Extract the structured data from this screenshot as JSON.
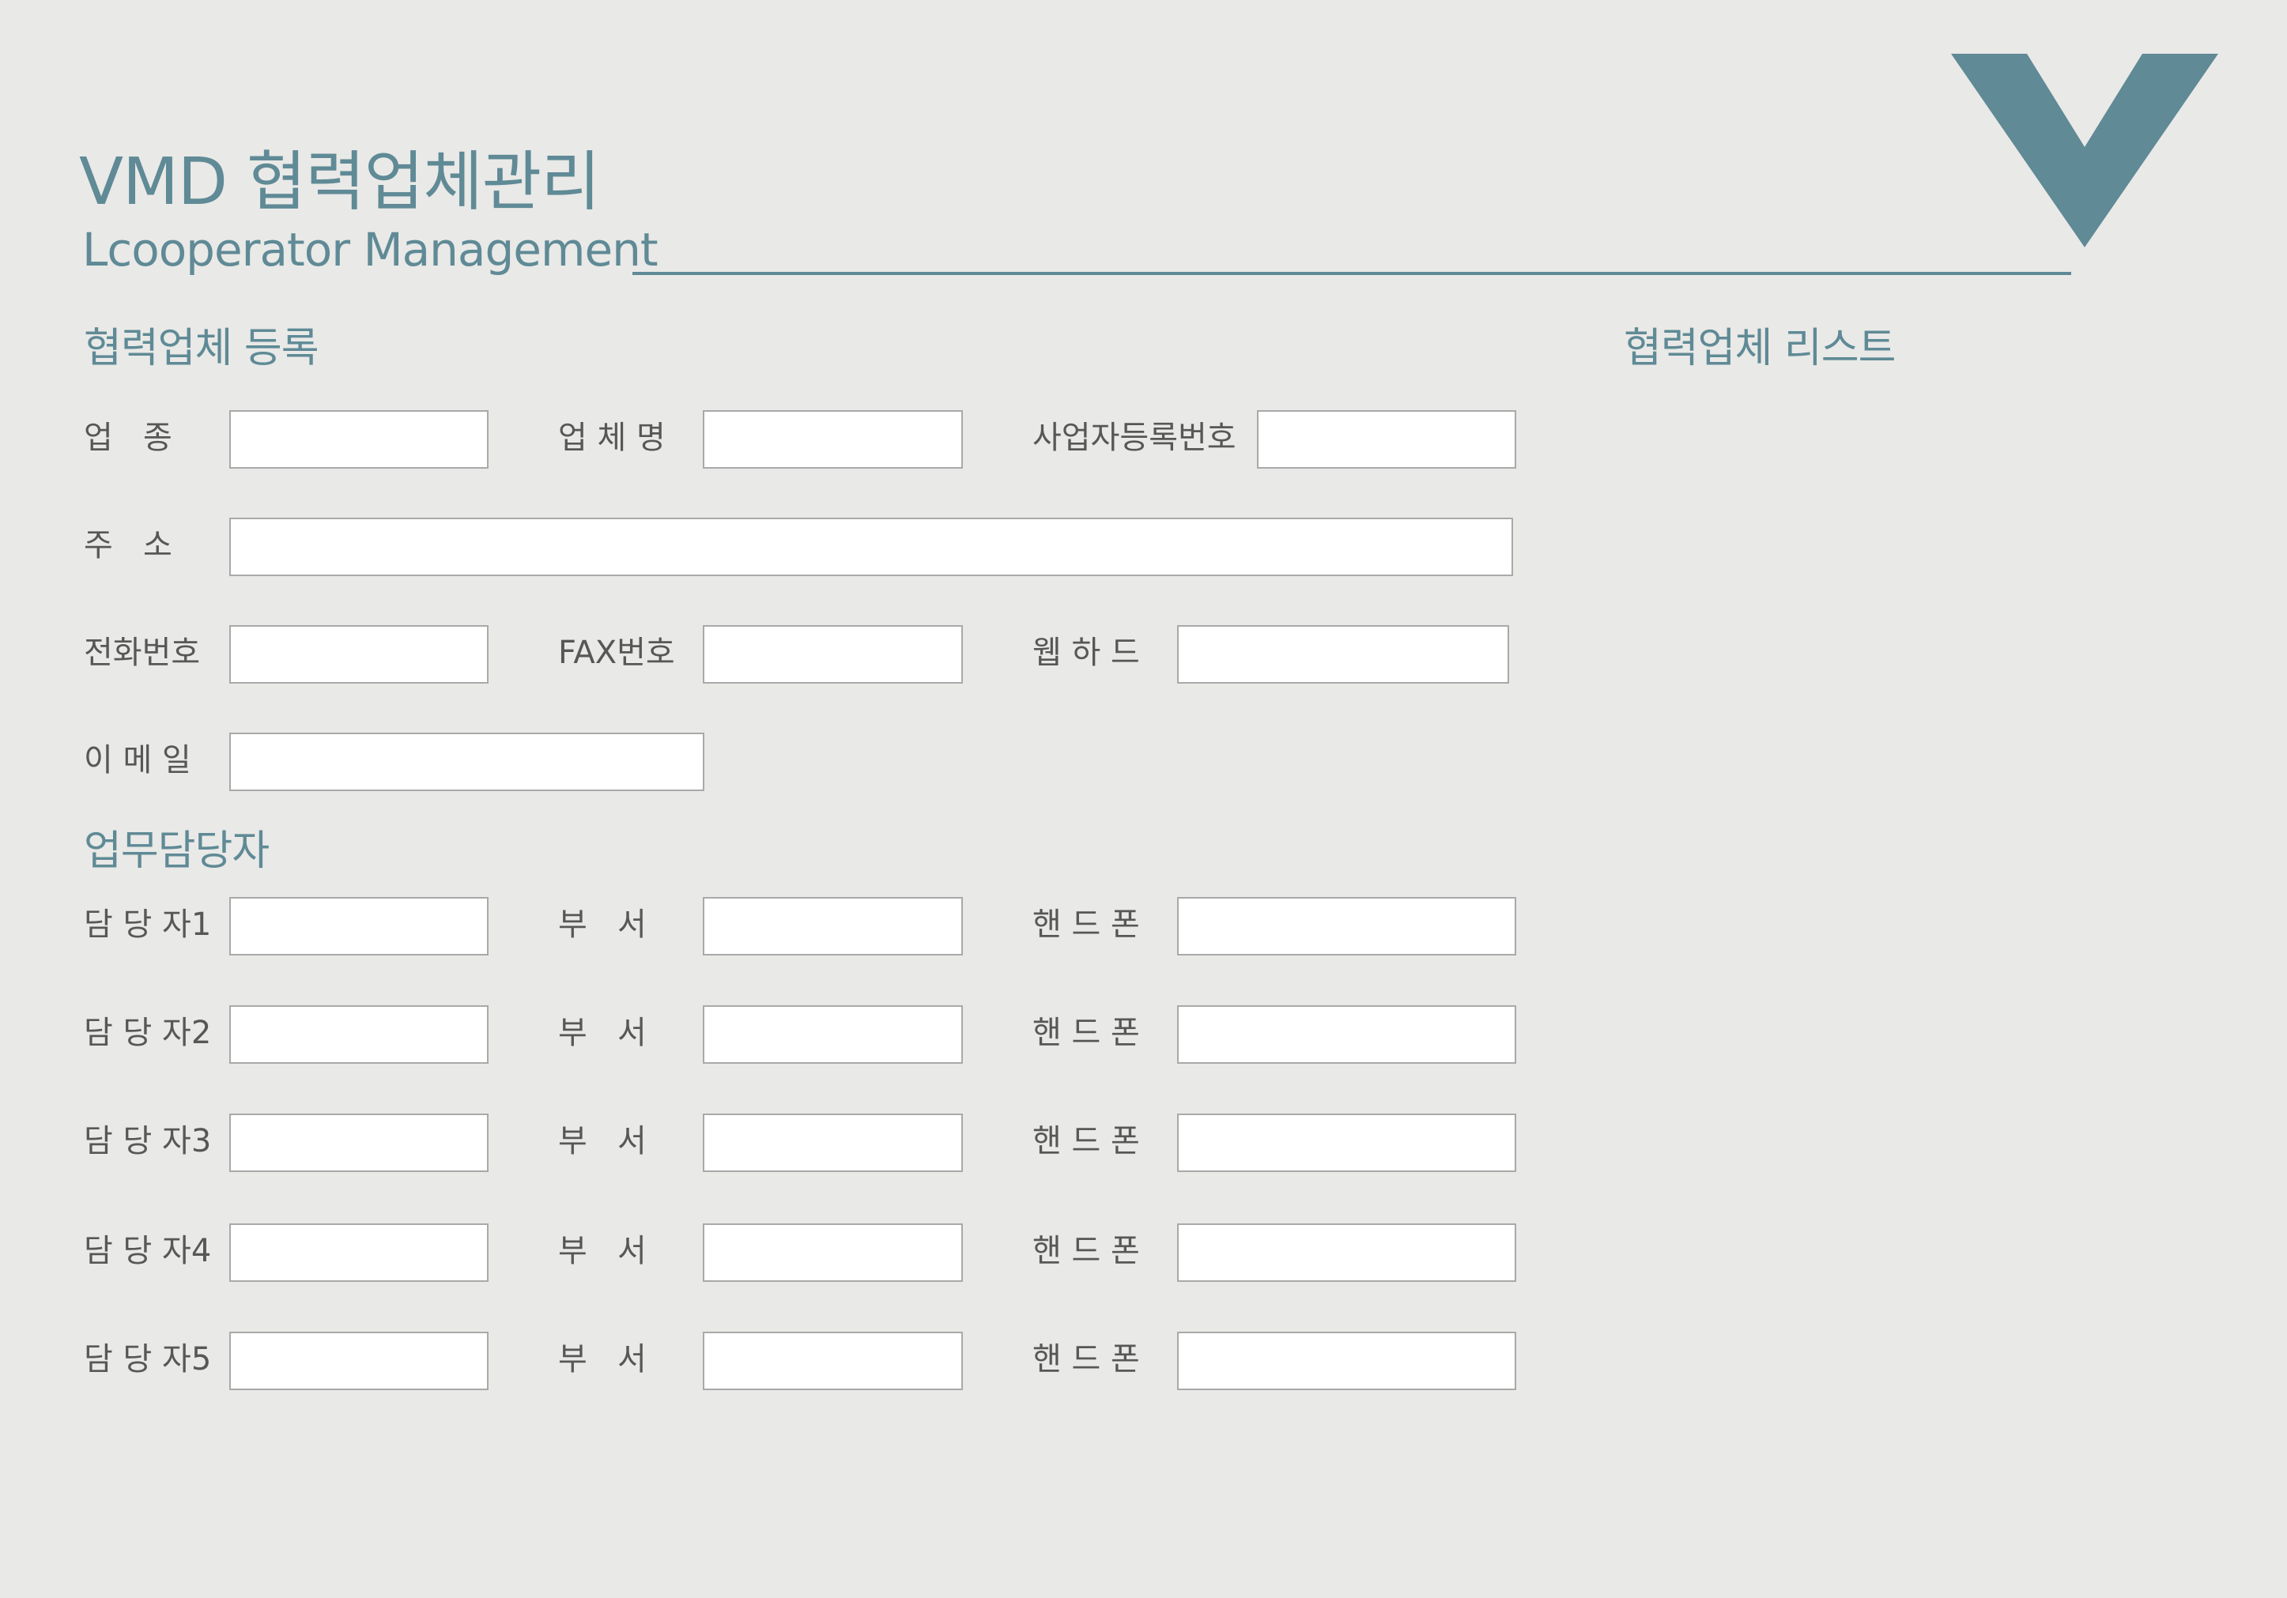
{
  "header": {
    "title": "VMD 협력업체관리",
    "subtitle": "Lcooperator Management",
    "logo": "v-chevron-logo",
    "accent_color": "#5f8a96"
  },
  "registration": {
    "section_title": "협력업체 등록",
    "fields": {
      "industry": {
        "label": "업   종",
        "value": ""
      },
      "company_name": {
        "label": "업 체 명",
        "value": ""
      },
      "business_reg_no": {
        "label": "사업자등록번호",
        "value": ""
      },
      "address": {
        "label": "주   소",
        "value": ""
      },
      "phone": {
        "label": "전화번호",
        "value": ""
      },
      "fax": {
        "label": "FAX번호",
        "value": ""
      },
      "webhard": {
        "label": "웹 하 드",
        "value": ""
      },
      "email": {
        "label": "이 메 일",
        "value": ""
      }
    }
  },
  "contacts": {
    "section_title": "업무담당자",
    "rows": [
      {
        "person_label": "담 당 자1",
        "dept_label": "부   서",
        "phone_label": "핸 드 폰",
        "person": "",
        "dept": "",
        "phone": ""
      },
      {
        "person_label": "담 당 자2",
        "dept_label": "부   서",
        "phone_label": "핸 드 폰",
        "person": "",
        "dept": "",
        "phone": ""
      },
      {
        "person_label": "담 당 자3",
        "dept_label": "부   서",
        "phone_label": "핸 드 폰",
        "person": "",
        "dept": "",
        "phone": ""
      },
      {
        "person_label": "담 당 자4",
        "dept_label": "부   서",
        "phone_label": "핸 드 폰",
        "person": "",
        "dept": "",
        "phone": ""
      },
      {
        "person_label": "담 당 자5",
        "dept_label": "부   서",
        "phone_label": "핸 드 폰",
        "person": "",
        "dept": "",
        "phone": ""
      }
    ]
  },
  "list": {
    "section_title": "협력업체 리스트"
  }
}
